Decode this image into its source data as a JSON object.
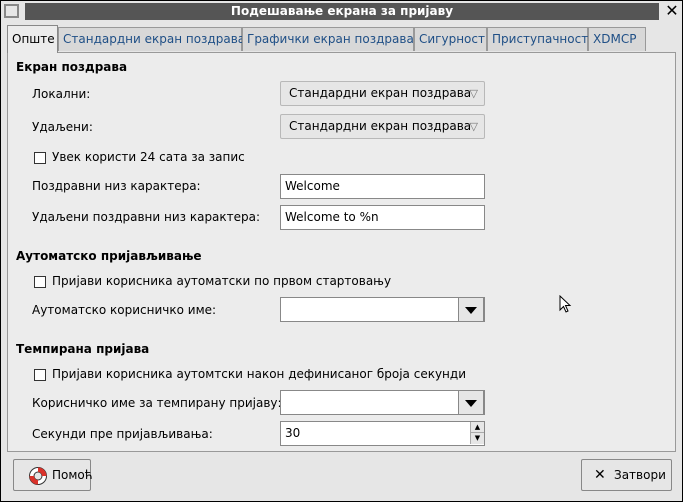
{
  "window": {
    "title": "Подешавање екрана за пријаву"
  },
  "tabs": [
    {
      "label": "Опште",
      "active": true
    },
    {
      "label": "Стандардни екран поздрава",
      "active": false
    },
    {
      "label": "Графички екран поздрава",
      "active": false
    },
    {
      "label": "Сигурност",
      "active": false
    },
    {
      "label": "Приступачност",
      "active": false
    },
    {
      "label": "XDMCP",
      "active": false
    }
  ],
  "greeter": {
    "section_title": "Екран поздрава",
    "local_label": "Локални:",
    "local_value": "Стандардни екран поздрава",
    "remote_label": "Удаљени:",
    "remote_value": "Стандардни екран поздрава",
    "clock24_label": "Увек користи 24 сата за запис",
    "clock24_checked": false,
    "welcome_label": "Поздравни низ карактера:",
    "welcome_value": "Welcome",
    "remote_welcome_label": "Удаљени поздравни низ карактера:",
    "remote_welcome_value": "Welcome to %n"
  },
  "autologin": {
    "section_title": "Аутоматско пријављивање",
    "checkbox_label": "Пријави корисника аутоматски по првом стартовању",
    "checked": false,
    "username_label": "Аутоматско корисничко име:",
    "username_value": ""
  },
  "timed": {
    "section_title": "Темпирана пријава",
    "checkbox_label": "Пријави корисника аутомтски након дефинисаног броја секунди",
    "checked": false,
    "username_label": "Корисничко име за темпирану пријаву:",
    "username_value": "",
    "seconds_label": "Секунди пре пријављивања:",
    "seconds_value": "30"
  },
  "buttons": {
    "help_label": "Помоћ",
    "close_label": "Затвори"
  }
}
